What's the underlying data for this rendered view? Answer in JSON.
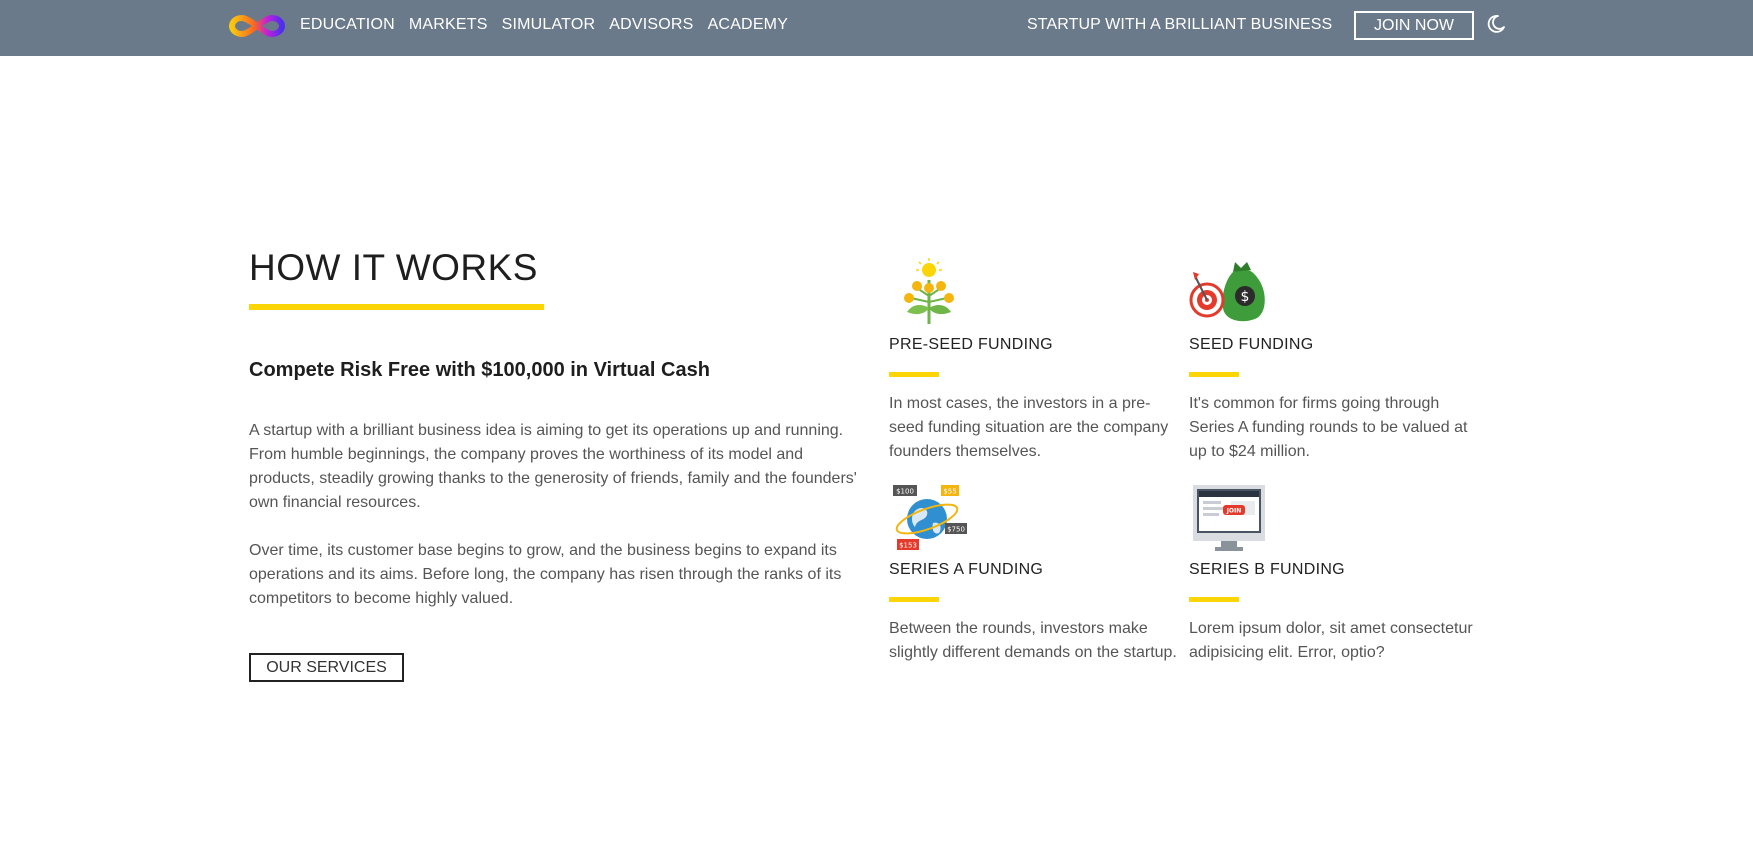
{
  "navbar": {
    "logo_icon": "infinity-logo-icon",
    "links": [
      "EDUCATION",
      "MARKETS",
      "SIMULATOR",
      "ADVISORS",
      "ACADEMY"
    ],
    "tagline": "STARTUP WITH A BRILLIANT BUSINESS",
    "join_label": "JOIN NOW",
    "theme_icon": "moon-icon",
    "bg_color": "#6b7a8a"
  },
  "how": {
    "title": "HOW IT WORKS",
    "subtitle": "Compete Risk Free with $100,000 in Virtual Cash",
    "paragraphs": [
      "A startup with a brilliant business idea is aiming to get its operations up and running. From humble beginnings, the company proves the worthiness of its model and products, steadily growing thanks to the generosity of friends, family and the founders' own financial resources.",
      "Over time, its customer base begins to grow, and the business begins to expand its operations and its aims. Before long, the company has risen through the ranks of its competitors to become highly valued."
    ],
    "button_label": "OUR SERVICES",
    "accent_color": "#fbd506"
  },
  "cards": [
    {
      "icon": "money-plant-icon",
      "title": "PRE-SEED FUNDING",
      "text": "In most cases, the investors in a pre-seed funding situation are the company founders themselves."
    },
    {
      "icon": "money-bag-target-icon",
      "title": "SEED FUNDING",
      "text": "It's common for firms going through Series A funding rounds to be valued at up to $24 million."
    },
    {
      "icon": "globe-money-icon",
      "title": "SERIES A FUNDING",
      "text": "Between the rounds, investors make slightly different demands on the startup.",
      "icon_labels": [
        "$100",
        "$55",
        "$750",
        "$153"
      ]
    },
    {
      "icon": "computer-join-icon",
      "title": "SERIES B FUNDING",
      "text": "Lorem ipsum dolor, sit amet consectetur adipisicing elit. Error, optio?",
      "icon_labels": [
        "JOIN"
      ]
    }
  ]
}
